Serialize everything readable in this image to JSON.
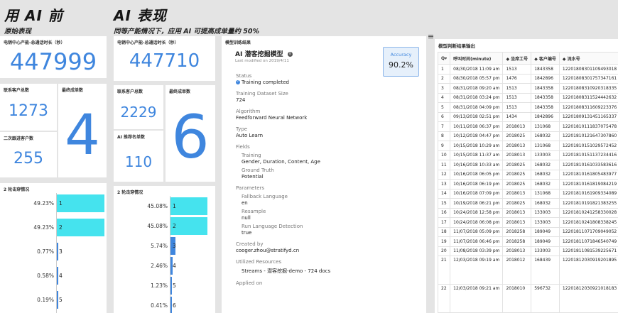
{
  "left_header": {
    "title": "用 AI 前",
    "subtitle": "原始表现"
  },
  "right_header": {
    "title": "AI 表现",
    "subtitle": "同等产能情况下，应用 AI 可提高成单量约 50%"
  },
  "before": {
    "talk_time": {
      "label": "电销中心产能-总通话时长（秒）",
      "value": "447999"
    },
    "contacts": {
      "label": "联系客户总数",
      "value": "1273"
    },
    "deals": {
      "label": "最终成单数",
      "value": "4"
    },
    "second_followup": {
      "label": "二次跟进客户数",
      "value": "255"
    },
    "breakdown": {
      "label": "2 轮击穿情况",
      "rows": [
        {
          "pct": "49.23%",
          "fraction": 0.4923,
          "name": "1"
        },
        {
          "pct": "49.23%",
          "fraction": 0.4923,
          "name": "2"
        },
        {
          "pct": "0.77%",
          "fraction": 0.0077,
          "name": "3"
        },
        {
          "pct": "0.58%",
          "fraction": 0.0058,
          "name": "4"
        },
        {
          "pct": "0.19%",
          "fraction": 0.0019,
          "name": "5"
        }
      ]
    }
  },
  "after": {
    "talk_time": {
      "label": "电销中心产能-总通话时长（秒）",
      "value": "447710"
    },
    "contacts": {
      "label": "联系客户总数",
      "value": "2229"
    },
    "deals": {
      "label": "最终成单数",
      "value": "6"
    },
    "ai_recommended": {
      "label": "AI 推荐名单数",
      "value": "110"
    },
    "breakdown": {
      "label": "2 轮击穿情况",
      "rows": [
        {
          "pct": "45.08%",
          "fraction": 0.4508,
          "name": "1"
        },
        {
          "pct": "45.08%",
          "fraction": 0.4508,
          "name": "2"
        },
        {
          "pct": "5.74%",
          "fraction": 0.0574,
          "name": "3"
        },
        {
          "pct": "2.46%",
          "fraction": 0.0246,
          "name": "4"
        },
        {
          "pct": "1.23%",
          "fraction": 0.0123,
          "name": "5"
        },
        {
          "pct": "0.41%",
          "fraction": 0.0041,
          "name": "6"
        }
      ]
    }
  },
  "training": {
    "panel_label": "模型训练结果",
    "model_name": "AI 潜客挖掘模型",
    "last_modified": "Last modified on 2019/4/11",
    "accuracy_label": "Accuracy",
    "accuracy_value": "90.2%",
    "status_label": "Status",
    "status_value": "Training completed",
    "dataset_label": "Training Dataset Size",
    "dataset_value": "724",
    "algorithm_label": "Algorithm",
    "algorithm_value": "Feedforward Neural Network",
    "type_label": "Type",
    "type_value": "Auto Learn",
    "fields_label": "Fields",
    "fields_training_label": "Training",
    "fields_training_value": "Gender, Duration, Content, Age",
    "fields_truth_label": "Ground Truth",
    "fields_truth_value": "Potential",
    "params_label": "Parameters",
    "fallback_label": "Fallback Language",
    "fallback_value": "en",
    "resample_label": "Resample",
    "resample_value": "null",
    "runlang_label": "Run Language Detection",
    "runlang_value": "true",
    "created_label": "Created by",
    "created_value": "cooger.zhou@stratifyd.cn",
    "resources_label": "Utilized Resources",
    "resources_value": "Streams - 潜客挖掘-demo - 724 docs",
    "applied_label": "Applied on"
  },
  "results": {
    "panel_label": "模型判断结果输出",
    "columns": [
      "Q▾",
      "呼叫时间(minute)",
      "◆ 坐席工号",
      "◆ 客户编号",
      "◆ 流水号"
    ],
    "rows": [
      [
        "1",
        "08/30/2018 11:09 am",
        "1513",
        "1843358",
        "12201808301109493018"
      ],
      [
        "2",
        "08/30/2018 05:57 pm",
        "1476",
        "1842896",
        "12201808301757347161"
      ],
      [
        "3",
        "08/31/2018 09:20 am",
        "1513",
        "1843358",
        "12201808310920318335"
      ],
      [
        "4",
        "08/31/2018 03:24 pm",
        "1513",
        "1843358",
        "12201808311524442632"
      ],
      [
        "5",
        "08/31/2018 04:09 pm",
        "1513",
        "1843358",
        "12201808311609223376"
      ],
      [
        "6",
        "09/13/2018 02:51 pm",
        "1434",
        "1842896",
        "12201809131451165337"
      ],
      [
        "7",
        "10/11/2018 06:37 pm",
        "2018013",
        "131068",
        "12201810111837075478"
      ],
      [
        "8",
        "10/12/2018 04:47 pm",
        "2018025",
        "168032",
        "12201810121647307860"
      ],
      [
        "9",
        "10/15/2018 10:29 am",
        "2018013",
        "131068",
        "12201810151029572452"
      ],
      [
        "10",
        "10/15/2018 11:37 am",
        "2018013",
        "133003",
        "12201810151137234416"
      ],
      [
        "11",
        "10/16/2018 10:33 am",
        "2018025",
        "168032",
        "12201810161033583616"
      ],
      [
        "12",
        "10/16/2018 06:05 pm",
        "2018025",
        "168032",
        "12201810161805483977"
      ],
      [
        "13",
        "10/16/2018 06:19 pm",
        "2018025",
        "168032",
        "12201810161819084219"
      ],
      [
        "14",
        "10/16/2018 07:09 pm",
        "2018013",
        "131068",
        "12201810161909334089"
      ],
      [
        "15",
        "10/19/2018 06:21 pm",
        "2018025",
        "168032",
        "12201810191821383255"
      ],
      [
        "16",
        "10/24/2018 12:58 pm",
        "2018013",
        "133003",
        "12201810241258330028"
      ],
      [
        "17",
        "10/24/2018 06:08 pm",
        "2018013",
        "133003",
        "12201810241808338245"
      ],
      [
        "18",
        "11/07/2018 05:09 pm",
        "2018258",
        "189049",
        "12201811071709049052"
      ],
      [
        "19",
        "11/07/2018 06:46 pm",
        "2018258",
        "189049",
        "12201811071846540749"
      ],
      [
        "20",
        "11/08/2018 03:39 pm",
        "2018013",
        "133003",
        "12201811081539225671"
      ],
      [
        "21",
        "12/03/2018 09:19 am",
        "2018012",
        "168439",
        "12201812030919201895"
      ],
      [
        "22",
        "12/03/2018 09:21 am",
        "2018010",
        "596732",
        "12201812030921018183"
      ]
    ]
  },
  "colors": {
    "accent": "#3f86de",
    "bar": "#45e3ee",
    "background": "#e4e4e4"
  }
}
